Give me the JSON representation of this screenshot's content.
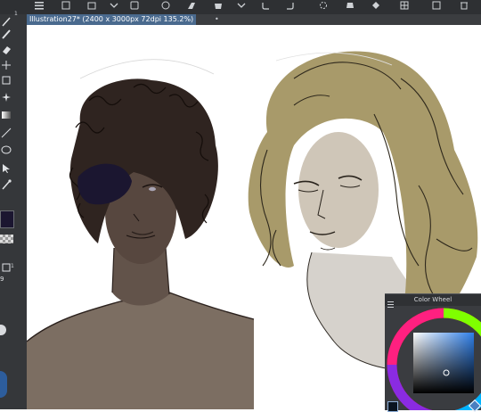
{
  "tab": {
    "title": "Illustration27* (2400 x 3000px 72dpi 135.2%)",
    "close_glyph": "•"
  },
  "toolbar_icons": [
    "menu-icon",
    "new-layer-icon",
    "transform-icon",
    "chevron-down-icon",
    "fill-icon",
    "add-icon",
    "eraser-icon",
    "chevron-down-icon",
    "undo-icon",
    "redo-icon",
    "loading-icon",
    "bucket-icon",
    "settings-icon",
    "grid-icon",
    "trash-icon"
  ],
  "left_tools": [
    "pen-icon",
    "brush-icon",
    "eraser-icon",
    "move-icon",
    "crop-icon",
    "magic-wand-icon",
    "gradient-icon",
    "line-icon",
    "lasso-icon",
    "selection-icon",
    "eyedropper-icon"
  ],
  "left_labels": {
    "top_number": "1",
    "layer_number": "1",
    "brush_size": "9"
  },
  "color_wheel": {
    "title": "Color Wheel",
    "selected_color": "#0a1420",
    "hue_color": "#2f7fe8"
  },
  "colors": {
    "current_color": "#1b1630",
    "hair_left": "#2f2420",
    "hair_right": "#a89a6a"
  }
}
